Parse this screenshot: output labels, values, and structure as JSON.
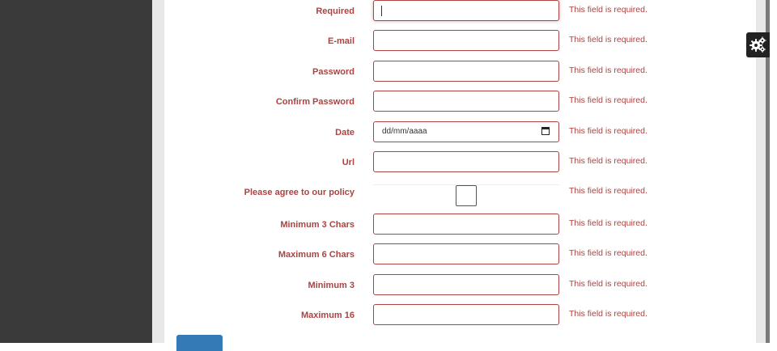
{
  "form": {
    "fields": [
      {
        "label": "Required",
        "type": "text",
        "value": "",
        "error": "This field is required."
      },
      {
        "label": "E-mail",
        "type": "email",
        "value": "",
        "error": "This field is required."
      },
      {
        "label": "Password",
        "type": "password",
        "value": "",
        "error": "This field is required."
      },
      {
        "label": "Confirm Password",
        "type": "password",
        "value": "",
        "error": "This field is required."
      },
      {
        "label": "Date",
        "type": "date",
        "value": "dd/mm/aaaa",
        "error": "This field is required."
      },
      {
        "label": "Url",
        "type": "url",
        "value": "",
        "error": "This field is required."
      },
      {
        "label": "Please agree to our policy",
        "type": "checkbox",
        "checked": false,
        "error": "This field is required."
      },
      {
        "label": "Minimum 3 Chars",
        "type": "text",
        "value": "",
        "error": "This field is required."
      },
      {
        "label": "Maximum 6 Chars",
        "type": "text",
        "value": "",
        "error": "This field is required."
      },
      {
        "label": "Minimum 3",
        "type": "number",
        "value": "",
        "error": "This field is required."
      },
      {
        "label": "Maximum 16",
        "type": "number",
        "value": "",
        "error": "This field is required."
      }
    ],
    "focused_field": "Required"
  },
  "icons": {
    "calendar": "calendar-icon",
    "settings": "gears-icon"
  },
  "colors": {
    "error": "#a94442",
    "sidebar": "#3a3a3a",
    "button": "#337ab7"
  }
}
